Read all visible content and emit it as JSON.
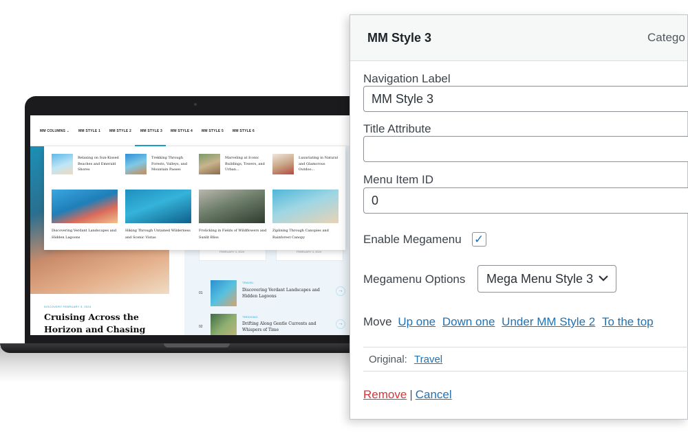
{
  "laptop": {
    "nav": [
      "MM COLUMNS ⌄",
      "MM STYLE 1",
      "MM STYLE 2",
      "MM STYLE 3",
      "MM STYLE 4",
      "MM STYLE 5",
      "MM STYLE 6"
    ],
    "mega_small": [
      "Relaxing on Sun-Kissed Beaches and Emerald Shores",
      "Trekking Through Forests, Valleys, and Mountain Passes",
      "Marveling at Iconic Buildings, Towers, and Urban...",
      "Luxuriating in Natural and Glamorous Outdoo..."
    ],
    "mega_big": [
      "Discovering Verdant Landscapes and Hidden Lagoons",
      "Hiking Through Untamed Wilderness and Scenic Vistas",
      "Frolicking in Fields of Wildflowers and Sunlit Bliss",
      "Ziplining Through Canopies and Rainforest Canopy"
    ],
    "card_dates": [
      "FEBRUARY 3, 2024",
      "FEBRUARY 3, 2024"
    ],
    "featured": {
      "meta": "DISCOVERY   FEBRUARY 3, 2024",
      "title": "Cruising Across the Horizon and Chasing Golden Hours"
    },
    "list": [
      {
        "num": "01",
        "cat": "TRAVEL",
        "title": "Discovering Verdant Landscapes and Hidden Lagoons"
      },
      {
        "num": "02",
        "cat": "TREKKING",
        "title": "Drifting Along Gentle Currents and Whispers of Time"
      }
    ],
    "arrow_icon": "→"
  },
  "panel": {
    "title": "MM Style 3",
    "type": "Catego",
    "nav_label_label": "Navigation Label",
    "nav_label_value": "MM Style 3",
    "title_attr_label": "Title Attribute",
    "title_attr_value": "",
    "menu_id_label": "Menu Item ID",
    "menu_id_value": "0",
    "megamenu_label": "Enable Megamenu",
    "megamenu_checked": true,
    "options_label": "Megamenu Options",
    "options_value": "Mega Menu Style 3",
    "move_label": "Move",
    "move_links": [
      "Up one",
      "Down one",
      "Under MM Style 2",
      "To the top"
    ],
    "original_label": "Original:",
    "original_link": "Travel",
    "remove": "Remove",
    "separator": "|",
    "cancel": "Cancel"
  },
  "colors": {
    "accent": "#1aa3c9",
    "wp_link": "#2271b1",
    "wp_remove": "#d63638"
  }
}
